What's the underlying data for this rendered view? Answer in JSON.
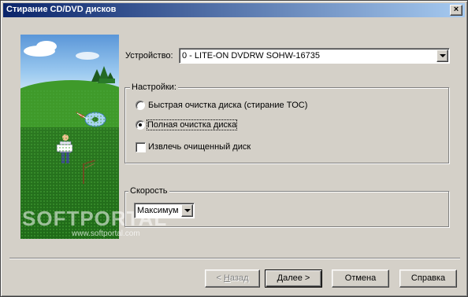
{
  "window": {
    "title": "Стирание CD/DVD дисков",
    "close_label": "×"
  },
  "picture": {
    "watermark_logo": "SOFTPORTAL",
    "watermark_url": "www.softportal.com"
  },
  "device": {
    "label": "Устройство:",
    "selected": "0 - LITE-ON  DVDRW SOHW-16735"
  },
  "settings": {
    "title": "Настройки:",
    "options": [
      {
        "label": "Быстрая очистка диска (стирание TOC)",
        "selected": false
      },
      {
        "label": "Полная очистка диска",
        "selected": true
      }
    ],
    "eject_label": "Извлечь очищенный диск",
    "eject_checked": false
  },
  "speed": {
    "title": "Скорость",
    "selected": "Максимум"
  },
  "buttons": {
    "back_underlined": "Н",
    "back_rest": "азад",
    "back_prefix": "< ",
    "next": "Далее >",
    "cancel": "Отмена",
    "help": "Справка"
  }
}
